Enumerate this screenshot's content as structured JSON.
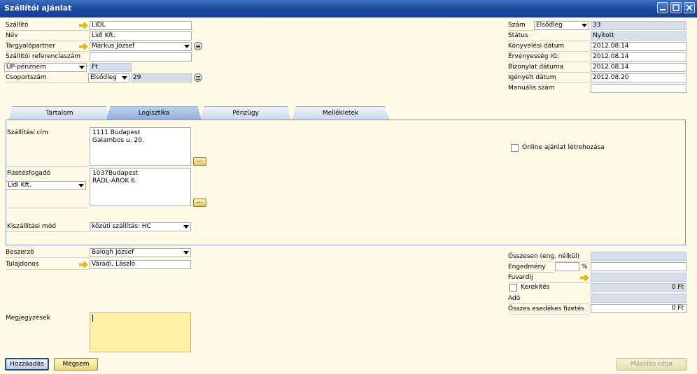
{
  "window": {
    "title": "Szállítói ajánlat"
  },
  "header_left": {
    "supplier": {
      "label": "Szállító",
      "value": "LIDL"
    },
    "name": {
      "label": "Név",
      "value": "Lidl Kft."
    },
    "contact": {
      "label": "Tárgyalópartner",
      "value": "Márkus József"
    },
    "vendor_ref": {
      "label": "Szállítói referenciaszám",
      "value": ""
    },
    "currency": {
      "label": "ÜP-pénznem",
      "value": "Ft"
    },
    "group_no": {
      "label": "Csoportszám",
      "series": "Elsődleg",
      "value": "29"
    }
  },
  "header_right": {
    "number": {
      "label": "Szám",
      "series": "Elsődleg",
      "value": "33"
    },
    "status": {
      "label": "Státus",
      "value": "Nyitott"
    },
    "posting_date": {
      "label": "Könyvelési dátum",
      "value": "2012.08.14"
    },
    "valid_until": {
      "label": "Érvényesség IG:",
      "value": "2012.08.14"
    },
    "doc_date": {
      "label": "Bizonylat dátuma",
      "value": "2012.08.14"
    },
    "required_date": {
      "label": "Igényelt dátum",
      "value": "2012.08.20"
    },
    "manual_number": {
      "label": "Manuális szám",
      "value": ""
    }
  },
  "tabs": [
    {
      "label": "Tartalom"
    },
    {
      "label": "Logisztika"
    },
    {
      "label": "Pénzügy"
    },
    {
      "label": "Mellékletek"
    }
  ],
  "logistics": {
    "ship_to": {
      "label": "Szállítási cím",
      "line1": "1111 Budapest",
      "line2": "Galambos u. 20."
    },
    "pay_to": {
      "label": "Fizetésfogadó",
      "select": "Lidl Kft.",
      "line1": "1037Budapest",
      "line2": "RÁDL-ÁROK 6."
    },
    "shipping_type": {
      "label": "Kiszállítási mód",
      "value": "közúti szállítás: HC"
    },
    "online_offer": {
      "label": "Online ajánlat létrehozása",
      "checked": false
    },
    "dots_label": "..."
  },
  "footer_left": {
    "buyer": {
      "label": "Beszerző",
      "value": "Balogh József"
    },
    "owner": {
      "label": "Tulajdonos",
      "value": "Váradi, László"
    },
    "remarks": {
      "label": "Megjegyzések",
      "value": ""
    }
  },
  "totals": {
    "total_before_discount": {
      "label": "Összesen (eng. nélkül)",
      "value": ""
    },
    "discount": {
      "label": "Engedmény",
      "percent": "",
      "percent_sign": "%",
      "value": ""
    },
    "freight": {
      "label": "Fuvardíj",
      "value": ""
    },
    "rounding": {
      "label": "Kerekítés",
      "value": "0 Ft",
      "checked": false
    },
    "tax": {
      "label": "Adó",
      "value": ""
    },
    "total_due": {
      "label": "Összes esedékes fizetés",
      "value": "0 Ft"
    }
  },
  "buttons": {
    "add": "Hozzáadás",
    "cancel": "Mégsem",
    "copy_to": "Másolás célja"
  }
}
